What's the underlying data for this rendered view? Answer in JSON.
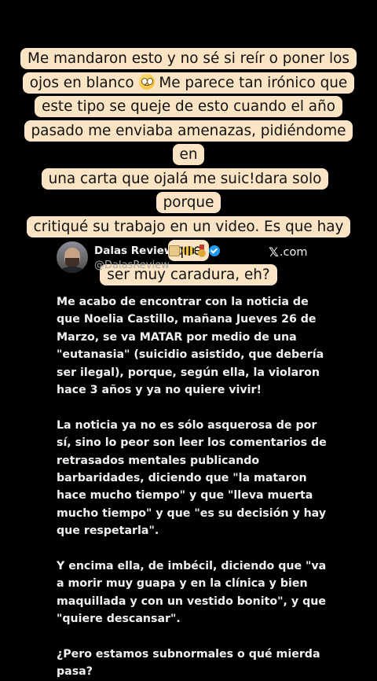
{
  "story": {
    "caption_lines": [
      "Me mandaron esto y no sé si reír o poner los",
      "ojos en blanco",
      "Me parece tan irónico que",
      "este tipo se queje de esto cuando el año",
      "pasado me enviaba amenazas, pidiéndome en",
      "una carta que ojalá me suic!dara solo porque",
      "critiqué su trabajo en un video. Es que hay que",
      "ser muy caradura, eh?"
    ],
    "caption_emoji": "face-with-rolling-eyes-emoji",
    "colors": {
      "background": "#000000",
      "caption_highlight": "#fbe4c4",
      "caption_text": "#111111",
      "verified": "#1d9bf0"
    }
  },
  "tweet": {
    "display_name": "Dalas Review",
    "handle": "@DalasReview",
    "source_logo": "𝕏",
    "source_suffix": ".com",
    "badges": [
      "box-emoji",
      "bee-emoji",
      "medal-emoji",
      "verified-badge-icon"
    ],
    "paragraphs": [
      "Me acabo de encontrar con la noticia de que Noelia Castillo, mañana Jueves 26 de Marzo, se va MATAR por medio de una \"eutanasia\" (suicidio asistido, que debería ser ilegal), porque, según ella, la violaron hace 3 años y ya no quiere vivir!",
      "La noticia ya no es sólo asquerosa de por sí, sino lo peor son leer los comentarios de retrasados mentales publicando barbaridades, diciendo que \"la mataron hace mucho tiempo\" y que \"lleva muerta mucho tiempo\" y que \"es su decisión y hay que respetarla\".",
      "Y encima ella, de imbécil, diciendo que \"va a morir muy guapa y en la clínica y bien maquillada y con un vestido bonito\", y que \"quiere descansar\".",
      "¿Pero estamos subnormales o qué mierda pasa?"
    ]
  }
}
